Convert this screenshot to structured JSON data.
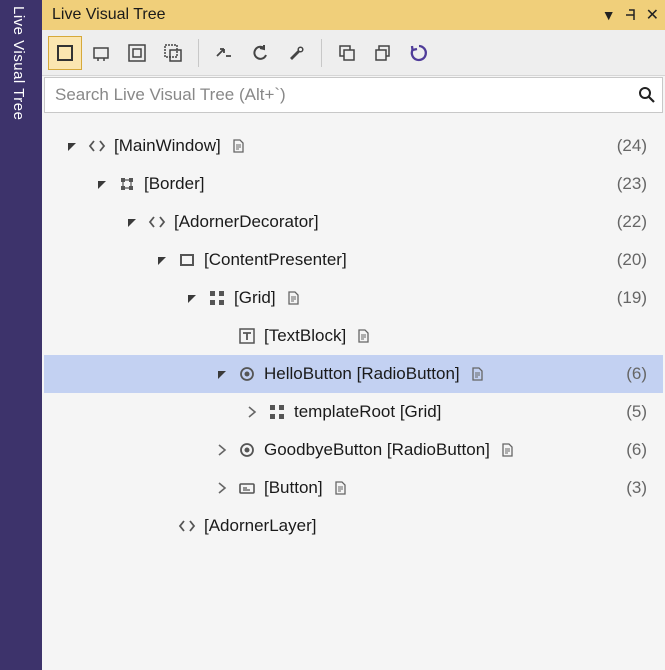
{
  "side_tab": "Live Visual Tree",
  "titlebar": {
    "title": "Live Visual Tree"
  },
  "search": {
    "placeholder": "Search Live Visual Tree (Alt+`)"
  },
  "toolbar_icons": [
    "select-element-icon",
    "layout-adorners-icon",
    "toggle-rect-icon",
    "attach-icon",
    "go-to-source-icon",
    "undo-icon",
    "wrench-icon",
    "window-group-icon",
    "window-group2-icon",
    "refresh-icon"
  ],
  "tree": [
    {
      "depth": 0,
      "chev": "down",
      "icon": "code",
      "label": "[MainWindow]",
      "doc": true,
      "count": "(24)"
    },
    {
      "depth": 1,
      "chev": "down",
      "icon": "border",
      "label": "[Border]",
      "doc": false,
      "count": "(23)"
    },
    {
      "depth": 2,
      "chev": "down",
      "icon": "code",
      "label": "[AdornerDecorator]",
      "doc": false,
      "count": "(22)"
    },
    {
      "depth": 3,
      "chev": "down",
      "icon": "content",
      "label": "[ContentPresenter]",
      "doc": false,
      "count": "(20)"
    },
    {
      "depth": 4,
      "chev": "down",
      "icon": "grid",
      "label": "[Grid]",
      "doc": true,
      "count": "(19)"
    },
    {
      "depth": 5,
      "chev": "none",
      "icon": "textblock",
      "label": "[TextBlock]",
      "doc": true,
      "count": ""
    },
    {
      "depth": 5,
      "chev": "down",
      "icon": "radio",
      "label": "HelloButton [RadioButton]",
      "doc": true,
      "count": "(6)",
      "selected": true
    },
    {
      "depth": 6,
      "chev": "right",
      "icon": "grid",
      "label": "templateRoot [Grid]",
      "doc": false,
      "count": "(5)"
    },
    {
      "depth": 5,
      "chev": "right",
      "icon": "radio",
      "label": "GoodbyeButton [RadioButton]",
      "doc": true,
      "count": "(6)"
    },
    {
      "depth": 5,
      "chev": "right",
      "icon": "button",
      "label": "[Button]",
      "doc": true,
      "count": "(3)"
    },
    {
      "depth": 3,
      "chev": "none",
      "icon": "code",
      "label": "[AdornerLayer]",
      "doc": false,
      "count": ""
    }
  ]
}
